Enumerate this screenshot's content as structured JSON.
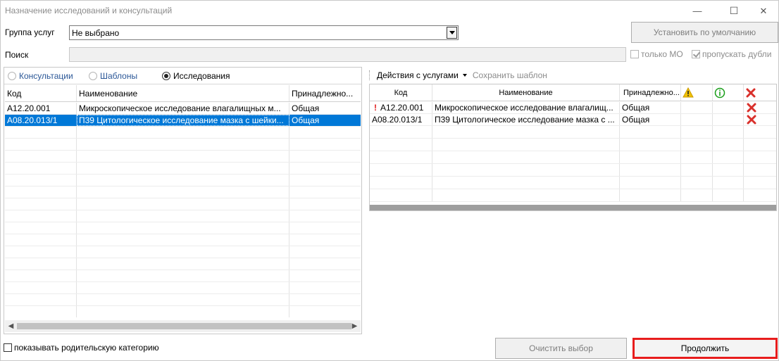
{
  "window": {
    "title": "Назначение исследований и консультаций",
    "minimize_glyph": "—",
    "maximize_glyph": "☐",
    "close_glyph": "✕"
  },
  "filters": {
    "group_label": "Группа услуг",
    "group_value": "Не выбрано",
    "search_label": "Поиск",
    "search_value": "",
    "default_button": "Установить по умолчанию",
    "only_mo_label": "только МО",
    "only_mo_checked": false,
    "skip_duplicates_label": "пропускать дубли",
    "skip_duplicates_checked": true
  },
  "left": {
    "tabs": [
      {
        "label": "Консультации",
        "selected": false
      },
      {
        "label": "Шаблоны",
        "selected": false
      },
      {
        "label": "Исследования",
        "selected": true
      }
    ],
    "columns": [
      "Код",
      "Наименование",
      "Принадлежно..."
    ],
    "rows": [
      {
        "code": "A12.20.001",
        "name": "Микроскопическое исследование влагалищных м...",
        "owner": "Общая",
        "selected": false
      },
      {
        "code": "A08.20.013/1",
        "name": "П39 Цитологическое исследование мазка с шейки...",
        "owner": "Общая",
        "selected": true
      }
    ],
    "show_parent_label": "показывать родительскую категорию",
    "show_parent_checked": false
  },
  "right": {
    "actions_label": "Действия с услугами",
    "save_template_label": "Сохранить шаблон",
    "columns": [
      "Код",
      "Наименование",
      "Принадлежно..."
    ],
    "icons": {
      "warning": "warning-icon",
      "info": "info-icon",
      "delete": "delete-icon"
    },
    "rows": [
      {
        "code": "A12.20.001",
        "name": "Микроскопическое исследование влагалищ...",
        "owner": "Общая",
        "flag": "!"
      },
      {
        "code": "A08.20.013/1",
        "name": "П39 Цитологическое исследование мазка с ...",
        "owner": "Общая",
        "flag": ""
      }
    ]
  },
  "footer": {
    "clear_button": "Очистить выбор",
    "continue_button": "Продолжить"
  },
  "colors": {
    "selection": "#0078d7",
    "highlight_border": "#e81d1d",
    "warning": "#f2c200",
    "info": "#1a9e1a",
    "delete": "#d9302b"
  }
}
